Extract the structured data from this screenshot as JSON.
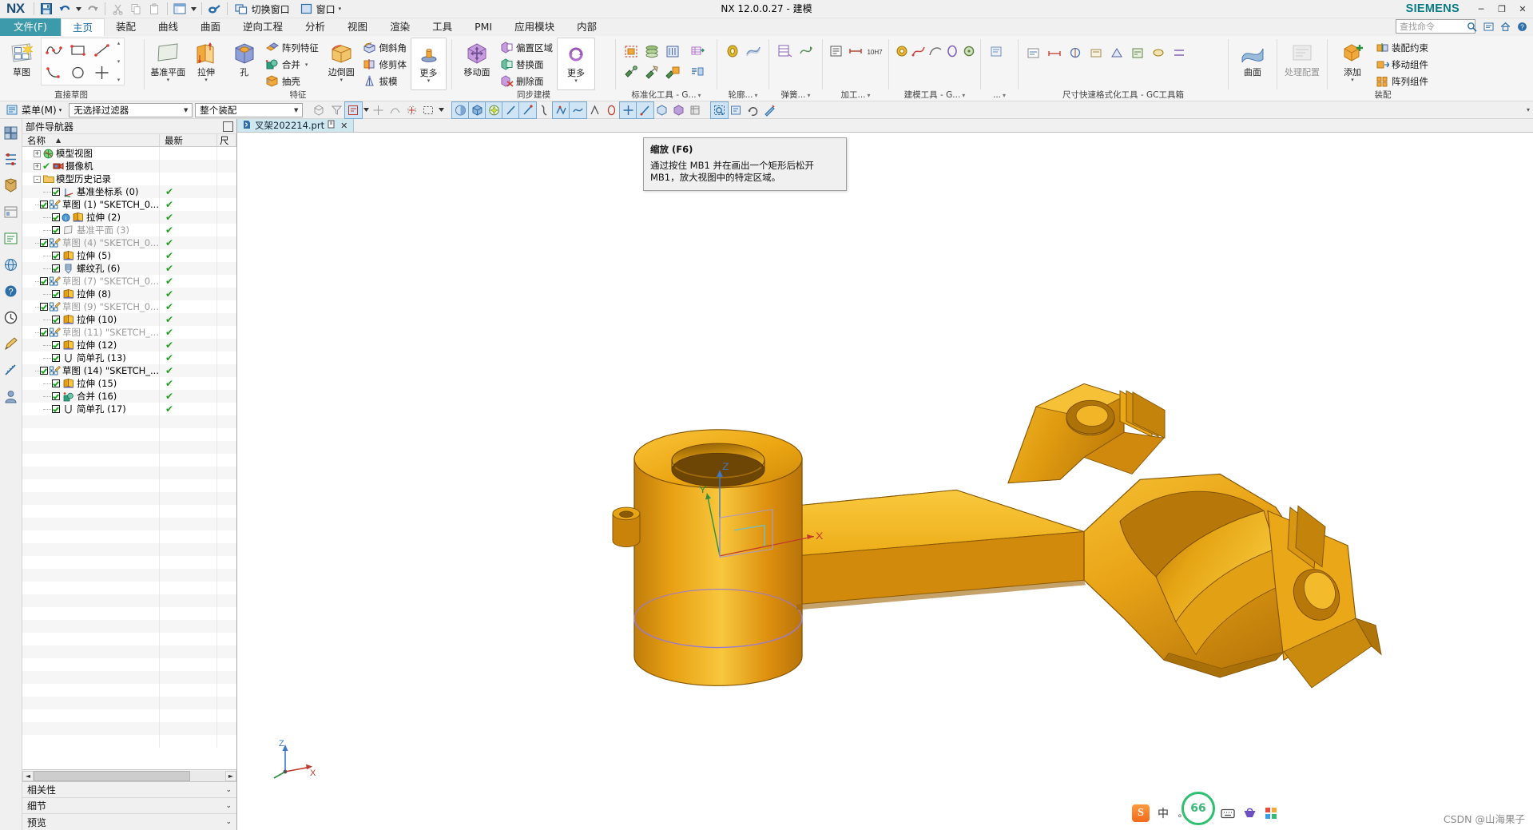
{
  "window": {
    "title": "NX 12.0.0.27 - 建模",
    "brand": "SIEMENS",
    "minimize": "─",
    "maximize": "❐",
    "close": "✕"
  },
  "quick_access": {
    "logo": "NX",
    "items": [
      {
        "name": "save-button",
        "label": ""
      },
      {
        "name": "undo-button",
        "label": ""
      },
      {
        "name": "redo-button",
        "label": ""
      },
      {
        "name": "cut-button",
        "label": ""
      },
      {
        "name": "copy-button",
        "label": ""
      },
      {
        "name": "paste-button",
        "label": ""
      }
    ],
    "switch_window": "切换窗口",
    "window_menu": "窗口"
  },
  "tabs": {
    "file": "文件(F)",
    "items": [
      "主页",
      "装配",
      "曲线",
      "曲面",
      "逆向工程",
      "分析",
      "视图",
      "渲染",
      "工具",
      "PMI",
      "应用模块",
      "内部"
    ],
    "active": "主页"
  },
  "search": {
    "placeholder": "查找命令"
  },
  "ribbon": {
    "groups": [
      {
        "name": "direct-sketch",
        "label": "直接草图",
        "big": [
          {
            "label": "草图",
            "icon": "sketch-icon"
          }
        ],
        "grid": [
          "studio-spline-icon",
          "rectangle-icon",
          "line-icon",
          "arc-icon",
          "circle-icon",
          "quick-trim-icon"
        ]
      },
      {
        "name": "feature",
        "label": "特征",
        "big": [
          {
            "label": "基准平面",
            "icon": "datum-plane-icon",
            "dropdown": true
          },
          {
            "label": "拉伸",
            "icon": "extrude-icon",
            "dropdown": true
          },
          {
            "label": "孔",
            "icon": "hole-icon"
          }
        ],
        "small": [
          {
            "label": "阵列特征",
            "icon": "pattern-feature-icon"
          },
          {
            "label": "合并",
            "icon": "unite-icon",
            "dropdown": true
          },
          {
            "label": "抽壳",
            "icon": "shell-icon"
          }
        ],
        "big2": [
          {
            "label": "边倒圆",
            "icon": "edge-blend-icon",
            "dropdown": true
          }
        ],
        "small2": [
          {
            "label": "倒斜角",
            "icon": "chamfer-icon"
          },
          {
            "label": "修剪体",
            "icon": "trim-body-icon"
          },
          {
            "label": "拔模",
            "icon": "draft-icon"
          }
        ],
        "more": {
          "label": "更多",
          "icon": "more-feature-icon"
        }
      },
      {
        "name": "synchronous-modeling",
        "label": "同步建模",
        "big": [
          {
            "label": "移动面",
            "icon": "move-face-icon"
          }
        ],
        "small": [
          {
            "label": "偏置区域",
            "icon": "offset-region-icon"
          },
          {
            "label": "替换面",
            "icon": "replace-face-icon"
          },
          {
            "label": "删除面",
            "icon": "delete-face-icon"
          }
        ],
        "more": {
          "label": "更多",
          "icon": "more-sync-icon"
        }
      },
      {
        "name": "standardization-tools",
        "label": "标准化工具 - G...",
        "dropdown": true
      },
      {
        "name": "contour",
        "label": "轮廓...",
        "dropdown": true
      },
      {
        "name": "spring",
        "label": "弹簧...",
        "dropdown": true
      },
      {
        "name": "machining",
        "label": "加工...",
        "dropdown": true
      },
      {
        "name": "modeling-tools",
        "label": "建模工具 - G...",
        "dropdown": true
      },
      {
        "name": "etc",
        "label": "...",
        "dropdown": true
      },
      {
        "name": "dimension-quick-format",
        "label": "尺寸快速格式化工具 - GC工具箱"
      },
      {
        "name": "curve",
        "label": "曲面",
        "big": [
          {
            "label": "曲面",
            "icon": "surface-icon"
          }
        ]
      },
      {
        "name": "process",
        "label": "",
        "big": [
          {
            "label": "处理配置",
            "icon": "config-icon"
          }
        ]
      },
      {
        "name": "assembly",
        "label": "装配",
        "big": [
          {
            "label": "添加",
            "icon": "add-component-icon",
            "dropdown": true
          }
        ],
        "small": [
          {
            "label": "装配约束",
            "icon": "assembly-constraint-icon"
          },
          {
            "label": "移动组件",
            "icon": "move-component-icon"
          },
          {
            "label": "阵列组件",
            "icon": "pattern-component-icon"
          }
        ]
      }
    ]
  },
  "selection_bar": {
    "menu": "菜单(M)",
    "filter": "无选择过滤器",
    "scope": "整个装配"
  },
  "navigator": {
    "title": "部件导航器",
    "columns": [
      "名称",
      "最新",
      "尺"
    ],
    "rows": [
      {
        "indent": 0,
        "expander": "+",
        "checkbox": false,
        "icon": "model-views-icon",
        "label": "模型视图",
        "dim": false,
        "status": ""
      },
      {
        "indent": 0,
        "expander": "+",
        "checkbox": false,
        "icon": "cameras-icon",
        "label": "摄像机",
        "dim": false,
        "status": "",
        "pre_check": true
      },
      {
        "indent": 0,
        "expander": "-",
        "checkbox": false,
        "icon": "folder-icon",
        "label": "模型历史记录",
        "dim": false,
        "status": ""
      },
      {
        "indent": 1,
        "checkbox": true,
        "icon": "datum-csys-icon",
        "label": "基准坐标系 (0)",
        "dim": false,
        "status": "ok"
      },
      {
        "indent": 1,
        "checkbox": true,
        "icon": "sketch-tree-icon",
        "label": "草图 (1) \"SKETCH_0...",
        "dim": false,
        "status": "ok"
      },
      {
        "indent": 1,
        "checkbox": true,
        "icon": "extrude-tree-icon",
        "label": "拉伸 (2)",
        "dim": false,
        "status": "ok",
        "info": true
      },
      {
        "indent": 1,
        "checkbox": true,
        "icon": "datum-plane-tree-icon",
        "label": "基准平面 (3)",
        "dim": true,
        "status": "ok"
      },
      {
        "indent": 1,
        "checkbox": true,
        "icon": "sketch-tree-icon",
        "label": "草图 (4) \"SKETCH_0...",
        "dim": true,
        "status": "ok"
      },
      {
        "indent": 1,
        "checkbox": true,
        "icon": "extrude-tree-icon",
        "label": "拉伸 (5)",
        "dim": false,
        "status": "ok"
      },
      {
        "indent": 1,
        "checkbox": true,
        "icon": "thread-hole-icon",
        "label": "螺纹孔 (6)",
        "dim": false,
        "status": "ok"
      },
      {
        "indent": 1,
        "checkbox": true,
        "icon": "sketch-tree-icon",
        "label": "草图 (7) \"SKETCH_0...",
        "dim": true,
        "status": "ok"
      },
      {
        "indent": 1,
        "checkbox": true,
        "icon": "extrude-tree-icon",
        "label": "拉伸 (8)",
        "dim": false,
        "status": "ok"
      },
      {
        "indent": 1,
        "checkbox": true,
        "icon": "sketch-tree-icon",
        "label": "草图 (9) \"SKETCH_0...",
        "dim": true,
        "status": "ok"
      },
      {
        "indent": 1,
        "checkbox": true,
        "icon": "extrude-tree-icon",
        "label": "拉伸 (10)",
        "dim": false,
        "status": "ok"
      },
      {
        "indent": 1,
        "checkbox": true,
        "icon": "sketch-tree-icon",
        "label": "草图 (11) \"SKETCH_...",
        "dim": true,
        "status": "ok"
      },
      {
        "indent": 1,
        "checkbox": true,
        "icon": "extrude-tree-icon",
        "label": "拉伸 (12)",
        "dim": false,
        "status": "ok"
      },
      {
        "indent": 1,
        "checkbox": true,
        "icon": "simple-hole-icon",
        "label": "简单孔 (13)",
        "dim": false,
        "status": "ok"
      },
      {
        "indent": 1,
        "checkbox": true,
        "icon": "sketch-tree-icon",
        "label": "草图 (14) \"SKETCH_...",
        "dim": false,
        "status": "ok"
      },
      {
        "indent": 1,
        "checkbox": true,
        "icon": "extrude-tree-icon",
        "label": "拉伸 (15)",
        "dim": false,
        "status": "ok"
      },
      {
        "indent": 1,
        "checkbox": true,
        "icon": "unite-tree-icon",
        "label": "合并 (16)",
        "dim": false,
        "status": "ok"
      },
      {
        "indent": 1,
        "checkbox": true,
        "icon": "simple-hole-icon",
        "label": "简单孔 (17)",
        "dim": false,
        "status": "ok"
      }
    ],
    "sections": [
      "相关性",
      "细节",
      "预览"
    ]
  },
  "document": {
    "tab_label": "叉架202214.prt",
    "tab_close": "✕"
  },
  "tooltip": {
    "title": "缩放 (F6)",
    "body": "通过按住 MB1 并在画出一个矩形后松开 MB1，放大视图中的特定区域。"
  },
  "viewport": {
    "triad_x": "X",
    "triad_y": "Y",
    "triad_z": "Z",
    "wcs_x": "X",
    "wcs_z": "Z",
    "watermark": "CSDN @山海果子",
    "model_colors": {
      "light": "#f5b315",
      "mid": "#e79a0c",
      "dark": "#c47a08",
      "darker": "#a86407",
      "edge": "#7a4a05"
    }
  },
  "ime": {
    "sogou_logo": "S",
    "mode": "中",
    "punct": "。，",
    "mic": "mic-icon",
    "keyboard": "keyboard-icon",
    "toolbox": "toolbox-icon",
    "apps": "apps-icon",
    "badge": "66"
  }
}
